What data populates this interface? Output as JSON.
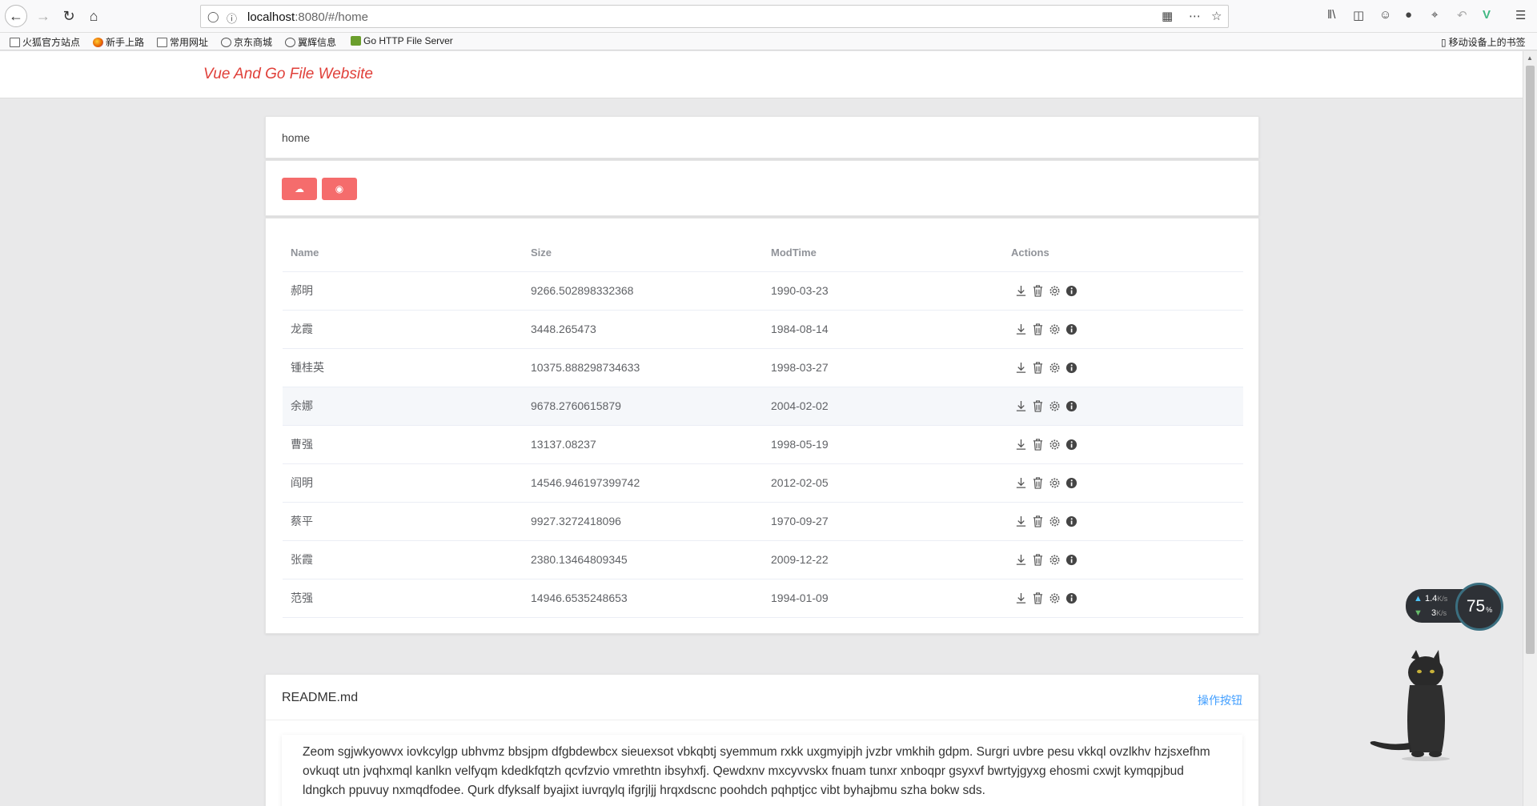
{
  "browser": {
    "url_host": "localhost",
    "url_rest": ":8080/#/home",
    "bookmarks": [
      "火狐官方站点",
      "新手上路",
      "常用网址",
      "京东商城",
      "翼辉信息",
      "Go HTTP File Server"
    ],
    "mobile_bookmarks": "移动设备上的书签"
  },
  "app": {
    "brand": "Vue And Go File Website",
    "breadcrumb": "home"
  },
  "table": {
    "headers": {
      "name": "Name",
      "size": "Size",
      "modtime": "ModTime",
      "actions": "Actions"
    },
    "rows": [
      {
        "name": "郝明",
        "size": "9266.502898332368",
        "modtime": "1990-03-23"
      },
      {
        "name": "龙霞",
        "size": "3448.265473",
        "modtime": "1984-08-14"
      },
      {
        "name": "锺桂英",
        "size": "10375.888298734633",
        "modtime": "1998-03-27"
      },
      {
        "name": "余娜",
        "size": "9678.2760615879",
        "modtime": "2004-02-02"
      },
      {
        "name": "曹强",
        "size": "13137.08237",
        "modtime": "1998-05-19"
      },
      {
        "name": "阎明",
        "size": "14546.946197399742",
        "modtime": "2012-02-05"
      },
      {
        "name": "蔡平",
        "size": "9927.3272418096",
        "modtime": "1970-09-27"
      },
      {
        "name": "张霞",
        "size": "2380.13464809345",
        "modtime": "2009-12-22"
      },
      {
        "name": "范强",
        "size": "14946.6535248653",
        "modtime": "1994-01-09"
      }
    ]
  },
  "readme": {
    "title": "README.md",
    "action": "操作按钮",
    "text": "Zeom sgjwkyowvx iovkcylgp ubhvmz bbsjpm dfgbdewbcx sieuexsot vbkqbtj syemmum rxkk uxgmyipjh jvzbr vmkhih gdpm. Surgri uvbre pesu vkkql ovzlkhv hzjsxefhm ovkuqt utn jvqhxmql kanlkn velfyqm kdedkfqtzh qcvfzvio vmrethtn ibsyhxfj. Qewdxnv mxcyvvskx fnuam tunxr xnboqpr gsyxvf bwrtyjgyxg ehosmi cxwjt kymqpjbud ldngkch ppuvuy nxmqdfodee. Qurk dfyksalf byajixt iuvrqylq ifgrjljj hrqxdscnc poohdch pqhptjcc vibt byhajbmu szha bokw sds."
  },
  "widgets": {
    "upload_speed": "1.4",
    "download_speed": "3",
    "speed_unit": "K/s",
    "cpu_percent": "75",
    "percent_sign": "%"
  }
}
